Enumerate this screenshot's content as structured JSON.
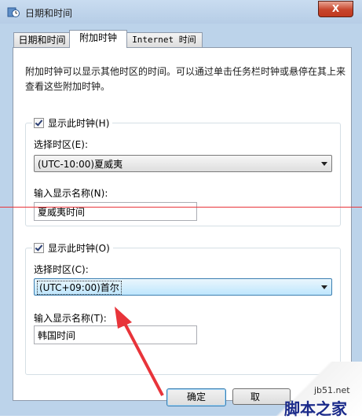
{
  "window": {
    "title": "日期和时间",
    "close_label": "X"
  },
  "tabs": [
    {
      "label": "日期和时间"
    },
    {
      "label": "附加时钟"
    },
    {
      "label": "Internet 时间"
    }
  ],
  "description": "附加时钟可以显示其他时区的时间。可以通过单击任务栏时钟或悬停在其上来查看这些附加时钟。",
  "clock1": {
    "show_label": "显示此时钟(H)",
    "checked": true,
    "timezone_label": "选择时区(E):",
    "timezone_value": "(UTC-10:00)夏威夷",
    "name_label": "输入显示名称(N):",
    "name_value": "夏威夷时间"
  },
  "clock2": {
    "show_label": "显示此时钟(O)",
    "checked": true,
    "timezone_label": "选择时区(C):",
    "timezone_value": "(UTC+09:00)首尔",
    "name_label": "输入显示名称(T):",
    "name_value": "韩国时间"
  },
  "buttons": {
    "ok": "确定",
    "cancel": "取"
  },
  "watermark": {
    "url": "jb51.net",
    "name": "脚本之家"
  },
  "colors": {
    "annotation_red": "#e8343a",
    "titlebar": "#c9dcf0",
    "close": "#c7452c"
  }
}
